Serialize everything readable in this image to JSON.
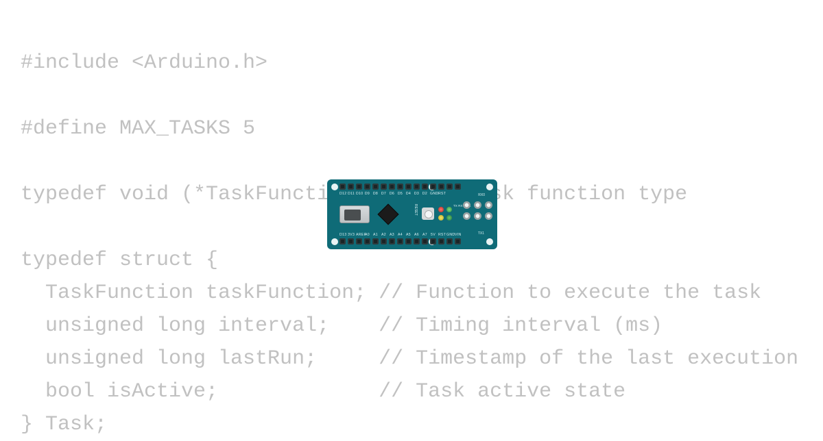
{
  "code": {
    "lines": [
      "#include <Arduino.h>",
      "",
      "#define MAX_TASKS 5",
      "",
      "typedef void (*TaskFunction)();  // Task function type",
      "",
      "typedef struct {",
      "  TaskFunction taskFunction; // Function to execute the task",
      "  unsigned long interval;    // Timing interval (ms)",
      "  unsigned long lastRun;     // Timestamp of the last execution",
      "  bool isActive;             // Task active state",
      "} Task;"
    ]
  },
  "board": {
    "name": "Arduino Nano",
    "pin_labels_top": [
      "D12",
      "D11",
      "D10",
      "D9",
      "D8",
      "D7",
      "D6",
      "D5",
      "D4",
      "D3",
      "D2",
      "GND",
      "RST"
    ],
    "pin_labels_bottom": [
      "D13",
      "3V3",
      "AREF",
      "A0",
      "A1",
      "A2",
      "A3",
      "A4",
      "A5",
      "A6",
      "A7",
      "5V",
      "RST",
      "GND",
      "VIN"
    ],
    "reset_label": "RESET",
    "led_labels": "TX RX\nON L",
    "rx0": "RX0",
    "tx1": "TX1"
  }
}
